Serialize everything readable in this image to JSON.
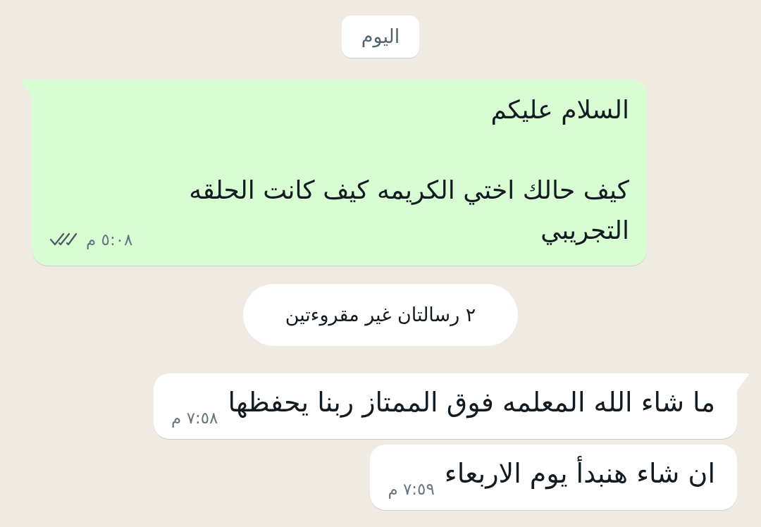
{
  "chat": [
    {
      "kind": "date",
      "text": "اليوم"
    },
    {
      "kind": "outgoing_message",
      "tail": true,
      "text": "السلام عليكم\n\nكيف حالك اختي الكريمه كيف كانت الحلقه التجريبي",
      "time": "٥:٠٨ م",
      "read": false
    },
    {
      "kind": "unread",
      "text": "٢ رسالتان غير مقروءتين"
    },
    {
      "kind": "incoming_message",
      "tail": true,
      "text": "ما شاء الله المعلمه فوق الممتاز ربنا يحفظها",
      "time": "٧:٥٨ م"
    },
    {
      "kind": "incoming_message",
      "tail": false,
      "text": "ان شاء هنبدأ يوم الاربعاء",
      "time": "٧:٥٩ م"
    }
  ]
}
